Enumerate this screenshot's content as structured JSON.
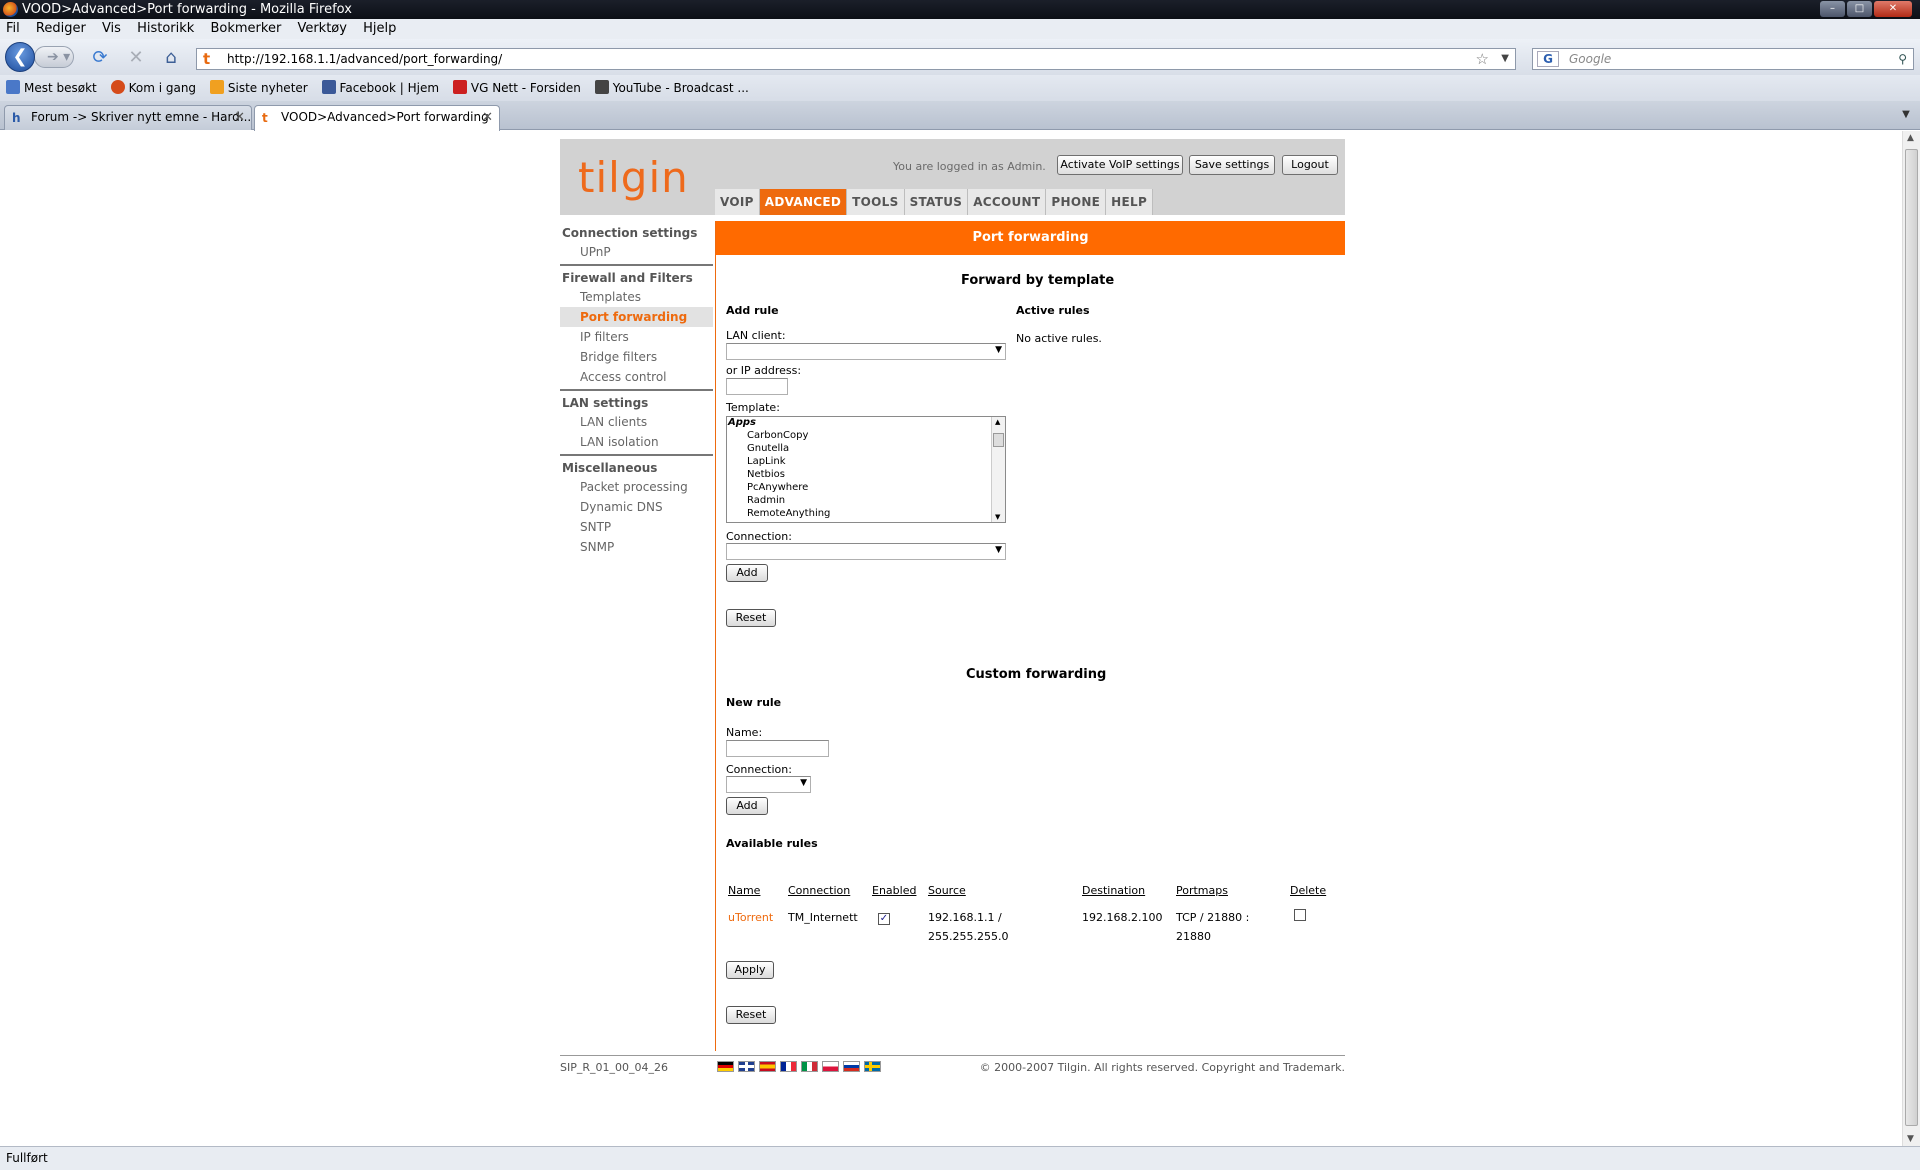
{
  "browser": {
    "window_title": "VOOD>Advanced>Port forwarding - Mozilla Firefox",
    "menu": [
      "Fil",
      "Rediger",
      "Vis",
      "Historikk",
      "Bokmerker",
      "Verktøy",
      "Hjelp"
    ],
    "url": "http://192.168.1.1/advanced/port_forwarding/",
    "search_placeholder": "Google",
    "bookmarks": [
      {
        "label": "Mest besøkt",
        "icon": "bookmark-folder-icon",
        "color": "#4a78c8"
      },
      {
        "label": "Kom i gang",
        "icon": "firefox-icon",
        "color": "#d54b1a"
      },
      {
        "label": "Siste nyheter",
        "icon": "rss-icon",
        "color": "#f0a020"
      },
      {
        "label": "Facebook | Hjem",
        "icon": "facebook-icon",
        "color": "#3b5998"
      },
      {
        "label": "VG Nett - Forsiden",
        "icon": "vg-icon",
        "color": "#cc2020"
      },
      {
        "label": "YouTube - Broadcast ...",
        "icon": "youtube-icon",
        "color": "#444444"
      }
    ],
    "tabs": [
      {
        "label": "Forum -> Skriver nytt emne - Hard...",
        "icon": "hw-icon"
      },
      {
        "label": "VOOD>Advanced>Port forwarding",
        "icon": "tilgin-icon"
      }
    ],
    "status": "Fullført"
  },
  "router": {
    "logo": "tilgin",
    "login_text": "You are logged in as Admin.",
    "buttons": {
      "voip": "Activate VoIP settings",
      "save": "Save settings",
      "logout": "Logout"
    },
    "nav": [
      "VOIP",
      "ADVANCED",
      "TOOLS",
      "STATUS",
      "ACCOUNT",
      "PHONE",
      "HELP"
    ],
    "nav_active": "ADVANCED",
    "accent_color": "#ee6a0e",
    "sidebar": {
      "group1": {
        "title": "Connection settings",
        "items": [
          "UPnP"
        ]
      },
      "group2": {
        "title": "Firewall and Filters",
        "items": [
          "Templates",
          "Port forwarding",
          "IP filters",
          "Bridge filters",
          "Access control"
        ]
      },
      "group3": {
        "title": "LAN settings",
        "items": [
          "LAN clients",
          "LAN isolation"
        ]
      },
      "group4": {
        "title": "Miscellaneous",
        "items": [
          "Packet processing",
          "Dynamic DNS",
          "SNTP",
          "SNMP"
        ]
      }
    },
    "content": {
      "heading": "Port forwarding",
      "template_section": {
        "title": "Forward by template",
        "add_rule": "Add rule",
        "active_rules": "Active rules",
        "no_active": "No active rules.",
        "lan_client_label": "LAN client:",
        "ip_label": "or IP address:",
        "template_label": "Template:",
        "template_group": "Apps",
        "template_options": [
          "CarbonCopy",
          "Gnutella",
          "LapLink",
          "Netbios",
          "PcAnywhere",
          "Radmin",
          "RemoteAnything"
        ],
        "connection_label": "Connection:",
        "add_button": "Add",
        "reset_button": "Reset"
      },
      "custom_section": {
        "title": "Custom forwarding",
        "new_rule": "New rule",
        "name_label": "Name:",
        "connection_label": "Connection:",
        "add_button": "Add",
        "available_rules": "Available rules",
        "columns": [
          "Name",
          "Connection",
          "Enabled",
          "Source",
          "Destination",
          "Portmaps",
          "Delete"
        ],
        "rows": [
          {
            "name": "uTorrent",
            "connection": "TM_Internett",
            "enabled": true,
            "source_line1": "192.168.1.1 /",
            "source_line2": "255.255.255.0",
            "destination": "192.168.2.100",
            "portmaps_line1": "TCP / 21880 :",
            "portmaps_line2": "21880",
            "delete": false
          }
        ],
        "apply_button": "Apply",
        "reset_button": "Reset"
      }
    },
    "footer": {
      "version": "SIP_R_01_00_04_26",
      "copyright": "© 2000-2007 Tilgin. All rights reserved. Copyright and Trademark.",
      "flags": [
        "de-flag-icon",
        "uk-flag-icon",
        "es-flag-icon",
        "fr-flag-icon",
        "it-flag-icon",
        "pl-flag-icon",
        "ru-flag-icon",
        "se-flag-icon"
      ]
    }
  }
}
